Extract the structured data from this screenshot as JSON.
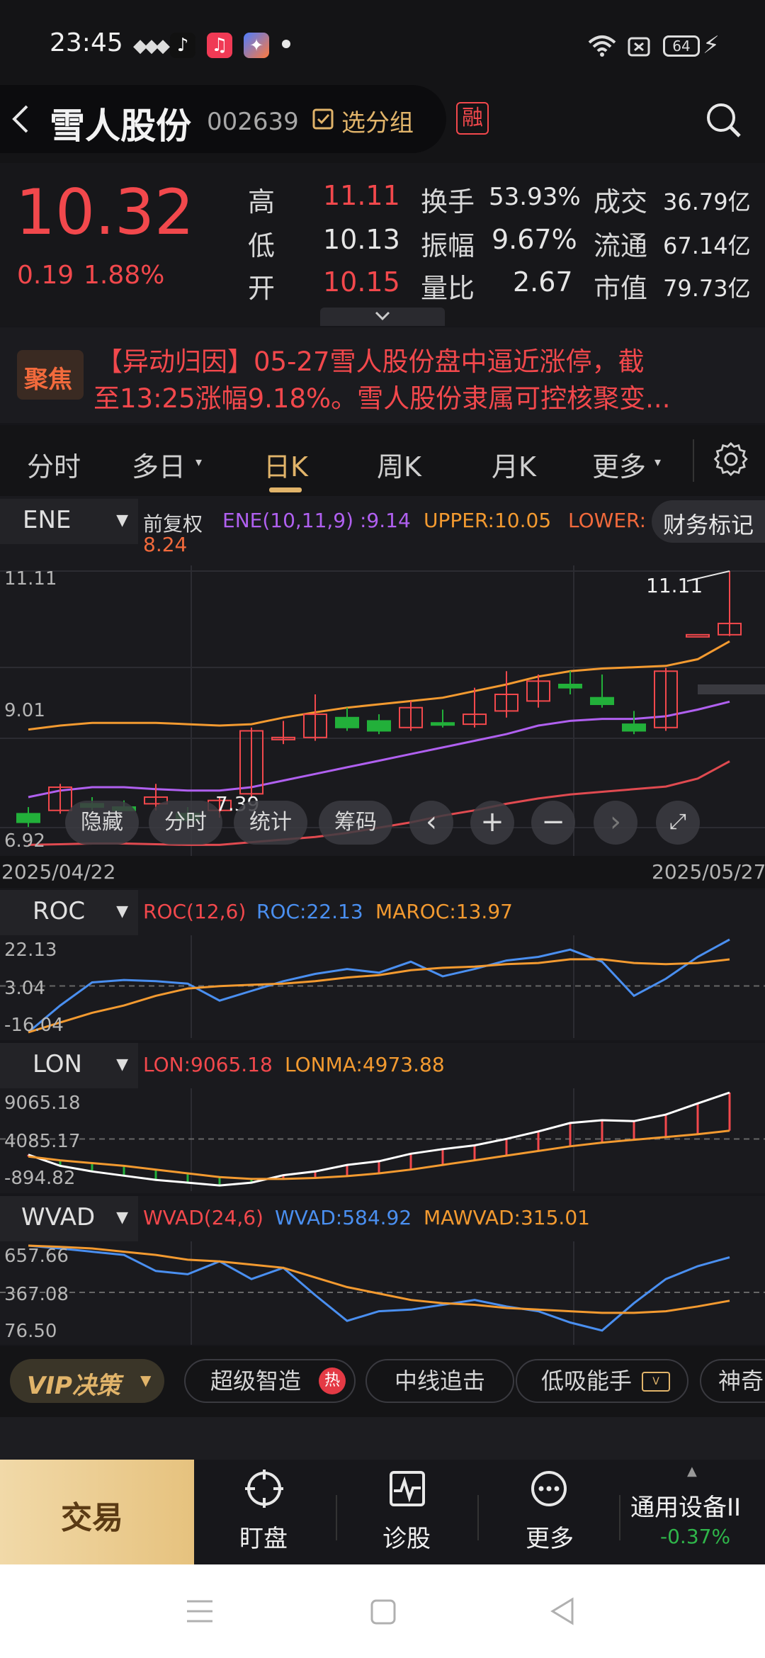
{
  "status_bar": {
    "time": "23:45",
    "battery": "64",
    "icons": [
      "signal-dots-icon",
      "tiktok-icon",
      "music-icon",
      "app-icon",
      "dot-icon",
      "wifi-icon",
      "sim-icon",
      "battery-icon",
      "charging-icon"
    ]
  },
  "header": {
    "stock_name": "雪人股份",
    "stock_code": "002639",
    "add_group_label": "选分组",
    "margin_badge": "融"
  },
  "quote": {
    "price": "10.32",
    "change": "0.19",
    "change_pct": "1.88%",
    "high_label": "高",
    "high": "11.11",
    "low_label": "低",
    "low": "10.13",
    "open_label": "开",
    "open": "10.15",
    "turnover_label": "换手",
    "turnover": "53.93%",
    "amplitude_label": "振幅",
    "amplitude": "9.67%",
    "volume_ratio_label": "量比",
    "volume_ratio": "2.67",
    "amount_label": "成交",
    "amount": "36.79亿",
    "float_label": "流通",
    "float_cap": "67.14亿",
    "mcap_label": "市值",
    "mcap": "79.73亿"
  },
  "news": {
    "badge": "聚焦",
    "line1": "【异动归因】05-27雪人股份盘中逼近涨停，截",
    "line2": "至13:25涨幅9.18%。雪人股份隶属可控核聚变..."
  },
  "tabs": [
    {
      "label": "分时"
    },
    {
      "label": "多日"
    },
    {
      "label": "日K"
    },
    {
      "label": "周K"
    },
    {
      "label": "月K"
    },
    {
      "label": "更多"
    }
  ],
  "main_chart": {
    "indicator": "ENE",
    "adjust": "前复权",
    "ene_label": "ENE(10,11,9)",
    "ene_value": ":9.14",
    "upper_label": "UPPER:10.05",
    "lower_label": "LOWER:",
    "lower_value": "8.24",
    "fin_mark": "财务标记",
    "y_top": "11.11",
    "y_mid": "9.01",
    "y_bottom": "6.92",
    "high_mark": "11.11",
    "low_mark": "7.39",
    "date_start": "2025/04/22",
    "date_end": "2025/05/27",
    "buttons": {
      "hide": "隐藏",
      "intraday": "分时",
      "stats": "统计",
      "chips": "筹码"
    }
  },
  "roc": {
    "indicator": "ROC",
    "param": "ROC(12,6)",
    "roc": "ROC:22.13",
    "maroc": "MAROC:13.97",
    "y_top": "22.13",
    "y_mid": "3.04",
    "y_bottom": "-16.04"
  },
  "lon": {
    "indicator": "LON",
    "lon": "LON:9065.18",
    "lonma": "LONMA:4973.88",
    "y_top": "9065.18",
    "y_mid": "4085.17",
    "y_bottom": "-894.82"
  },
  "wvad": {
    "indicator": "WVAD",
    "param": "WVAD(24,6)",
    "wvad": "WVAD:584.92",
    "mawvad": "MAWVAD:315.01",
    "y_top": "657.66",
    "y_mid": "367.08",
    "y_bottom": "76.50"
  },
  "strategies": {
    "vip": "VIP决策",
    "items": [
      "超级智造",
      "中线追击",
      "低吸能手",
      "神奇"
    ],
    "hot_badge": "热"
  },
  "bottom": {
    "trade": "交易",
    "watch": "盯盘",
    "diagnose": "诊股",
    "more": "更多",
    "sector_name": "通用设备II",
    "sector_change": "-0.37%"
  },
  "chart_data": [
    {
      "type": "candlestick",
      "title": "",
      "indicator_legend": [
        "ENE(10,11,9) :9.14",
        "UPPER:10.05",
        "LOWER: 8.24"
      ],
      "x_range": [
        "2025/04/22",
        "2025/05/27"
      ],
      "ylim": [
        6.92,
        11.11
      ],
      "y_ticks": [
        11.11,
        9.01,
        6.92
      ],
      "candles": [
        {
          "o": 7.45,
          "h": 7.55,
          "l": 7.25,
          "c": 7.32
        },
        {
          "o": 7.5,
          "h": 7.9,
          "l": 7.45,
          "c": 7.85
        },
        {
          "o": 7.6,
          "h": 7.7,
          "l": 7.5,
          "c": 7.55
        },
        {
          "o": 7.55,
          "h": 7.65,
          "l": 7.5,
          "c": 7.5
        },
        {
          "o": 7.6,
          "h": 7.9,
          "l": 7.5,
          "c": 7.7
        },
        {
          "o": 7.45,
          "h": 7.55,
          "l": 7.3,
          "c": 7.35
        },
        {
          "o": 7.5,
          "h": 7.7,
          "l": 7.39,
          "c": 7.65
        },
        {
          "o": 7.75,
          "h": 8.75,
          "l": 7.7,
          "c": 8.7
        },
        {
          "o": 8.6,
          "h": 8.85,
          "l": 8.5,
          "c": 8.6
        },
        {
          "o": 8.6,
          "h": 9.25,
          "l": 8.55,
          "c": 8.95
        },
        {
          "o": 8.9,
          "h": 9.05,
          "l": 8.7,
          "c": 8.75
        },
        {
          "o": 8.85,
          "h": 8.95,
          "l": 8.65,
          "c": 8.7
        },
        {
          "o": 8.75,
          "h": 9.15,
          "l": 8.7,
          "c": 9.05
        },
        {
          "o": 8.82,
          "h": 9.02,
          "l": 8.75,
          "c": 8.8
        },
        {
          "o": 8.8,
          "h": 9.35,
          "l": 8.75,
          "c": 8.95
        },
        {
          "o": 9.0,
          "h": 9.6,
          "l": 8.9,
          "c": 9.25
        },
        {
          "o": 9.15,
          "h": 9.55,
          "l": 9.05,
          "c": 9.45
        },
        {
          "o": 9.4,
          "h": 9.6,
          "l": 9.25,
          "c": 9.35
        },
        {
          "o": 9.2,
          "h": 9.55,
          "l": 9.05,
          "c": 9.1
        },
        {
          "o": 8.8,
          "h": 9.0,
          "l": 8.65,
          "c": 8.7
        },
        {
          "o": 8.75,
          "h": 9.65,
          "l": 8.7,
          "c": 9.6
        },
        {
          "o": 10.15,
          "h": 10.15,
          "l": 10.15,
          "c": 10.15
        },
        {
          "o": 10.15,
          "h": 11.11,
          "l": 10.13,
          "c": 10.32
        }
      ],
      "series": [
        {
          "name": "UPPER",
          "color": "#f39a30",
          "values": [
            8.72,
            8.78,
            8.82,
            8.82,
            8.82,
            8.8,
            8.78,
            8.8,
            8.9,
            8.98,
            9.05,
            9.1,
            9.15,
            9.2,
            9.3,
            9.4,
            9.52,
            9.6,
            9.64,
            9.66,
            9.68,
            9.78,
            10.05
          ]
        },
        {
          "name": "ENE",
          "color": "#b060f0",
          "values": [
            7.7,
            7.8,
            7.85,
            7.85,
            7.82,
            7.8,
            7.8,
            7.85,
            7.95,
            8.05,
            8.15,
            8.25,
            8.35,
            8.45,
            8.55,
            8.65,
            8.78,
            8.85,
            8.88,
            8.88,
            8.92,
            9.02,
            9.14
          ]
        },
        {
          "name": "LOWER",
          "color": "#e04a50",
          "values": [
            6.98,
            6.99,
            7.0,
            7.0,
            6.99,
            6.98,
            6.98,
            7.02,
            7.06,
            7.1,
            7.16,
            7.24,
            7.32,
            7.42,
            7.5,
            7.6,
            7.68,
            7.74,
            7.78,
            7.82,
            7.86,
            7.98,
            8.24
          ]
        }
      ]
    },
    {
      "type": "line",
      "title": "ROC(12,6)",
      "ylim": [
        -16.04,
        22.13
      ],
      "y_ticks": [
        22.13,
        3.04,
        -16.04
      ],
      "series": [
        {
          "name": "ROC",
          "color": "#4a8ff0",
          "values": [
            -16.0,
            -5,
            4.5,
            5.5,
            5.0,
            4.0,
            -3.0,
            1.0,
            5.0,
            8.0,
            10.0,
            8.5,
            13.0,
            7.0,
            10.0,
            13.5,
            15.0,
            18.0,
            13.0,
            -1.0,
            6.0,
            15.0,
            22.13
          ]
        },
        {
          "name": "MAROC",
          "color": "#f39a30",
          "values": [
            -16.0,
            -12,
            -8.0,
            -5.0,
            -1.0,
            2.0,
            3.0,
            3.5,
            4.0,
            5.0,
            6.5,
            7.5,
            9.5,
            10.5,
            11.0,
            12.0,
            12.5,
            14.0,
            14.0,
            12.5,
            12.0,
            12.5,
            13.97
          ]
        }
      ]
    },
    {
      "type": "line",
      "title": "",
      "ylim": [
        -894.82,
        9065.18
      ],
      "y_ticks": [
        9065.18,
        4085.17,
        -894.82
      ],
      "series": [
        {
          "name": "LON",
          "color": "#ffffff",
          "values": [
            2400,
            1200,
            600,
            150,
            -300,
            -600,
            -900,
            -600,
            200,
            600,
            1300,
            1700,
            2500,
            3000,
            3400,
            4100,
            4900,
            5800,
            6100,
            6000,
            6700,
            7900,
            9065.18
          ]
        },
        {
          "name": "LONMA",
          "color": "#f39a30",
          "values": [
            2200,
            1800,
            1500,
            1200,
            800,
            400,
            0,
            -200,
            -200,
            -100,
            100,
            400,
            800,
            1300,
            1800,
            2300,
            2800,
            3300,
            3700,
            4000,
            4300,
            4600,
            4973.88
          ]
        }
      ]
    },
    {
      "type": "line",
      "title": "WVAD(24,6)",
      "ylim": [
        76.5,
        657.66
      ],
      "y_ticks": [
        657.66,
        367.08,
        76.5
      ],
      "series": [
        {
          "name": "WVAD",
          "color": "#4a8ff0",
          "values": [
            657.66,
            640,
            620,
            600,
            500,
            480,
            560,
            450,
            520,
            350,
            190,
            250,
            260,
            290,
            320,
            280,
            250,
            180,
            130,
            300,
            450,
            530,
            584.92
          ]
        },
        {
          "name": "MAWVAD",
          "color": "#f39a30",
          "values": [
            657.66,
            650,
            640,
            620,
            600,
            570,
            560,
            540,
            520,
            460,
            400,
            360,
            320,
            300,
            290,
            270,
            260,
            250,
            240,
            240,
            250,
            280,
            315.01
          ]
        }
      ]
    }
  ]
}
